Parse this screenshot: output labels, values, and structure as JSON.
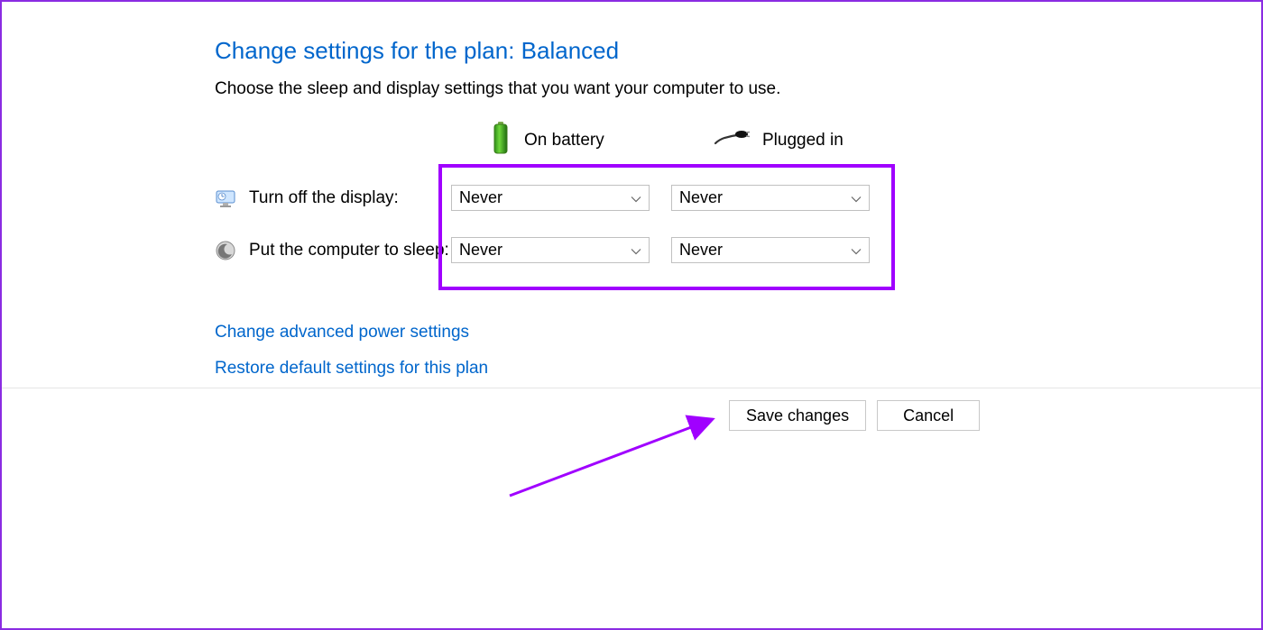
{
  "title": "Change settings for the plan: Balanced",
  "subtitle": "Choose the sleep and display settings that you want your computer to use.",
  "columns": {
    "battery": "On battery",
    "plugged": "Plugged in"
  },
  "rows": {
    "display": {
      "label": "Turn off the display:",
      "battery_value": "Never",
      "plugged_value": "Never"
    },
    "sleep": {
      "label": "Put the computer to sleep:",
      "battery_value": "Never",
      "plugged_value": "Never"
    }
  },
  "links": {
    "advanced": "Change advanced power settings",
    "restore": "Restore default settings for this plan"
  },
  "buttons": {
    "save": "Save changes",
    "cancel": "Cancel"
  }
}
